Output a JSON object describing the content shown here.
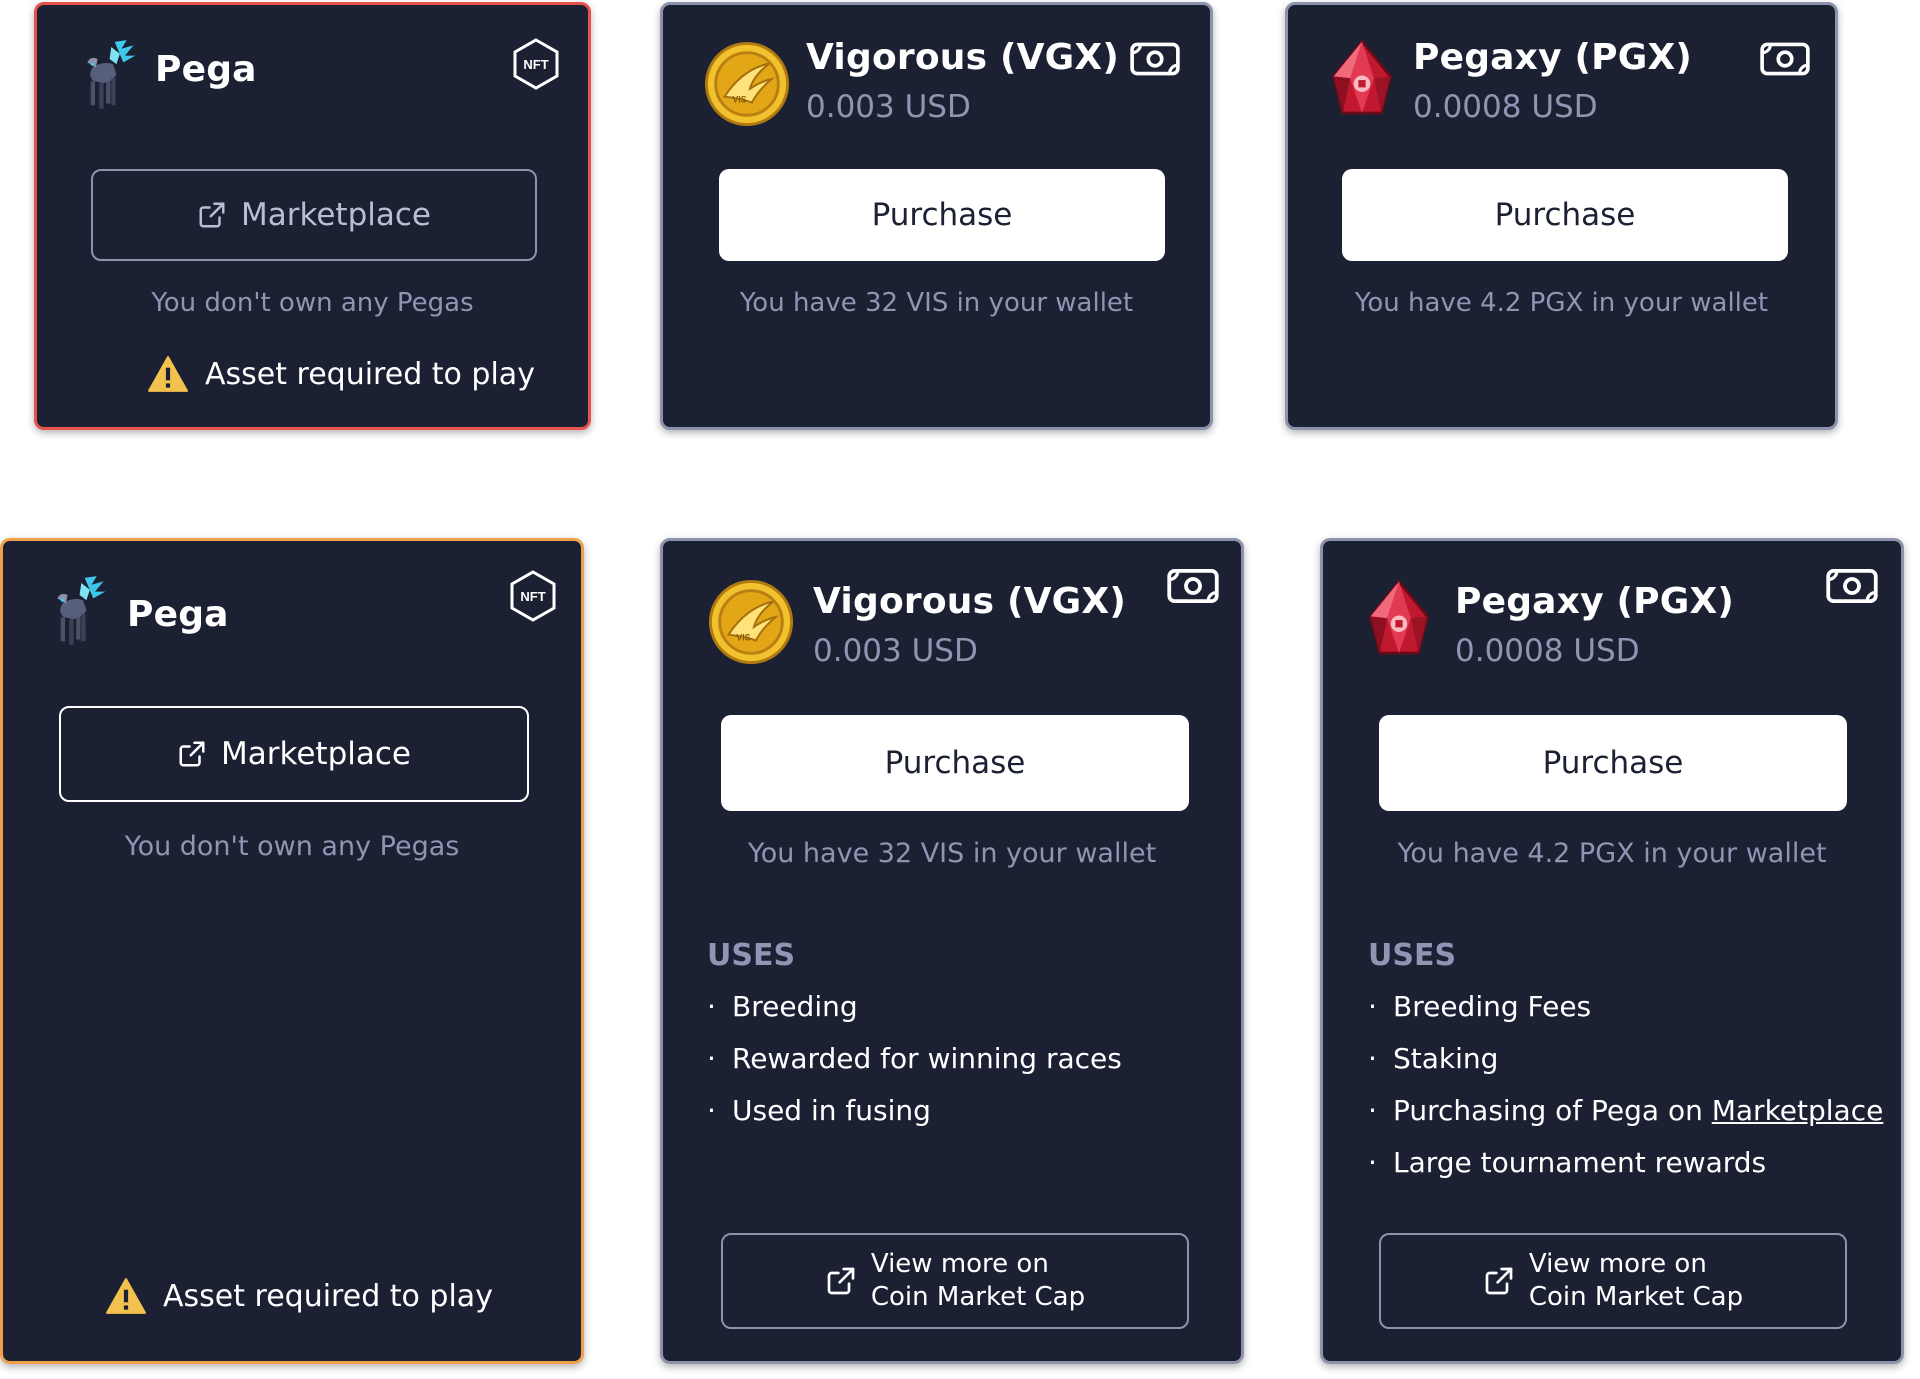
{
  "top_row": {
    "pega": {
      "title": "Pega",
      "badge": "NFT",
      "marketplace_label": "Marketplace",
      "status": "You don't own any Pegas",
      "warning": "Asset required to play"
    },
    "vgx": {
      "title": "Vigorous (VGX)",
      "price": "0.003 USD",
      "purchase_label": "Purchase",
      "wallet": "You have 32 VIS in your wallet"
    },
    "pgx": {
      "title": "Pegaxy (PGX)",
      "price": "0.0008 USD",
      "purchase_label": "Purchase",
      "wallet": "You have 4.2 PGX in your wallet"
    }
  },
  "bottom_row": {
    "pega": {
      "title": "Pega",
      "badge": "NFT",
      "marketplace_label": "Marketplace",
      "status": "You don't own any Pegas",
      "warning": "Asset required to play"
    },
    "vgx": {
      "title": "Vigorous (VGX)",
      "price": "0.003 USD",
      "purchase_label": "Purchase",
      "wallet": "You have 32 VIS in your wallet",
      "uses_heading": "USES",
      "uses": [
        "Breeding",
        "Rewarded for winning races",
        "Used in fusing"
      ],
      "cmc_line1": "View more on",
      "cmc_line2": "Coin Market Cap"
    },
    "pgx": {
      "title": "Pegaxy (PGX)",
      "price": "0.0008 USD",
      "purchase_label": "Purchase",
      "wallet": "You have 4.2 PGX in your wallet",
      "uses_heading": "USES",
      "uses": [
        "Breeding Fees",
        "Staking",
        "Purchasing of Pega on ",
        "Large tournament rewards"
      ],
      "uses_link": "Marketplace",
      "cmc_line1": "View more on",
      "cmc_line2": "Coin Market Cap"
    }
  },
  "icons": {
    "pega_avatar": "pega-horse-icon",
    "nft_badge": "nft-hexagon-icon",
    "vgx_coin": "vgx-gold-coin-icon",
    "pgx_gem": "pgx-red-gem-icon",
    "wallet": "cash-icon",
    "external_link": "external-link-icon",
    "warning": "warning-triangle-icon"
  },
  "colors": {
    "card_bg": "#1c2033",
    "card_border": "#8d93ad",
    "error_border": "#e5534b",
    "warning_border": "#f0a04b",
    "muted_text": "#8f95b2",
    "warning_icon": "#f2c14e",
    "coin_gold": "#e8b21c",
    "gem_red": "#d3263c"
  }
}
